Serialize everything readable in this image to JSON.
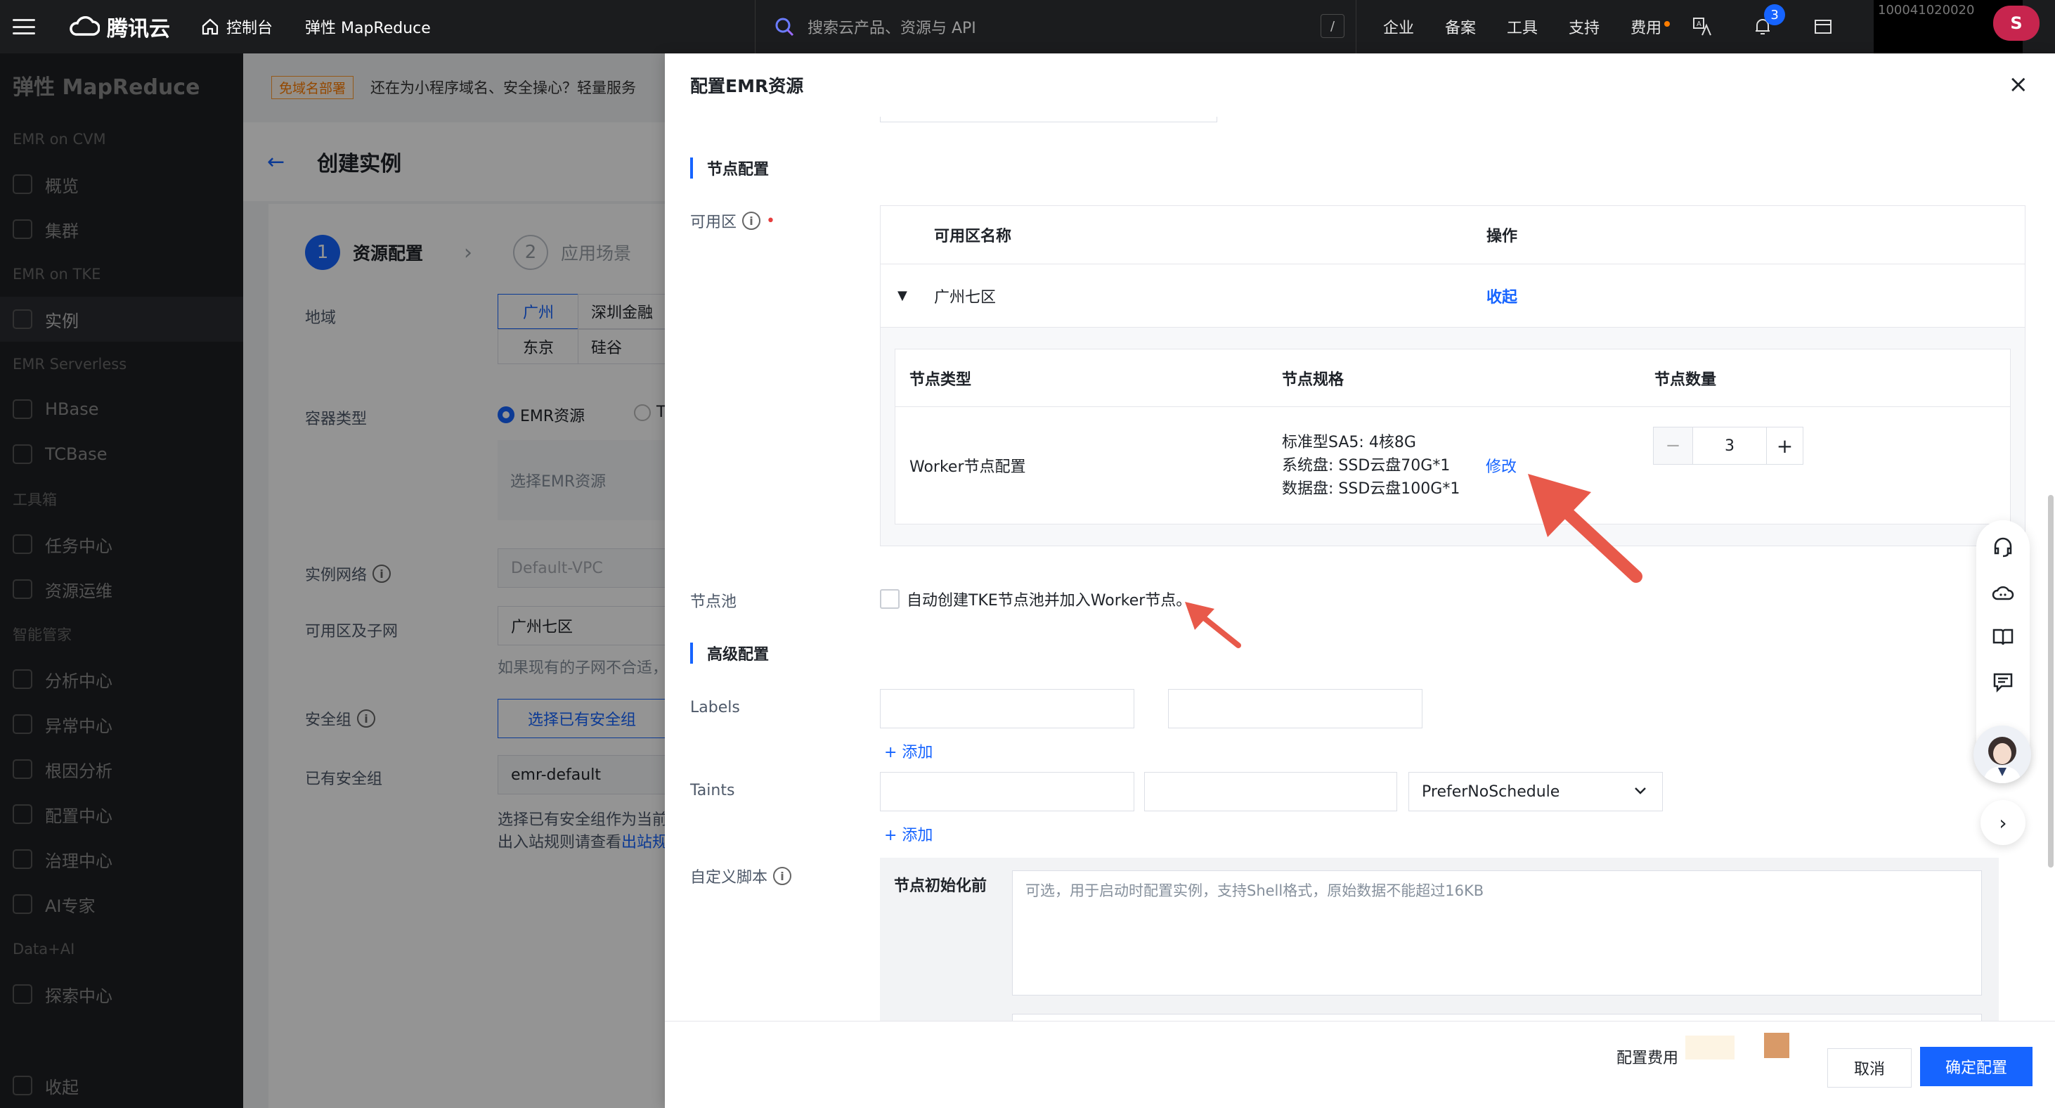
{
  "topbar": {
    "brand": "腾讯云",
    "console": "控制台",
    "product": "弹性 MapReduce",
    "search_placeholder": "搜索云产品、资源与 API",
    "search_shortcut": "/",
    "nav": [
      "企业",
      "备案",
      "工具",
      "支持",
      "费用"
    ],
    "notification_count": "3",
    "account_id": "100041020020",
    "avatar_letter": "S"
  },
  "sidebar": {
    "title": "弹性 MapReduce",
    "groups": [
      {
        "label": "EMR on CVM",
        "items": [
          {
            "label": "概览",
            "icon": "dashboard-icon"
          },
          {
            "label": "集群",
            "icon": "cluster-icon"
          }
        ]
      },
      {
        "label": "EMR on TKE",
        "items": [
          {
            "label": "实例",
            "icon": "instance-icon",
            "active": true
          }
        ]
      },
      {
        "label": "EMR Serverless",
        "items": [
          {
            "label": "HBase",
            "icon": "hbase-icon"
          },
          {
            "label": "TCBase",
            "icon": "tcbase-icon"
          }
        ]
      },
      {
        "label": "工具箱",
        "items": [
          {
            "label": "任务中心",
            "icon": "task-icon"
          },
          {
            "label": "资源运维",
            "icon": "ops-icon"
          }
        ]
      },
      {
        "label": "智能管家",
        "items": [
          {
            "label": "分析中心",
            "icon": "analysis-icon"
          },
          {
            "label": "异常中心",
            "icon": "alert-icon"
          },
          {
            "label": "根因分析",
            "icon": "rootcause-icon"
          },
          {
            "label": "配置中心",
            "icon": "config-icon"
          },
          {
            "label": "治理中心",
            "icon": "governance-icon"
          },
          {
            "label": "AI专家",
            "icon": "ai-icon"
          }
        ]
      },
      {
        "label": "Data+AI",
        "items": [
          {
            "label": "探索中心",
            "icon": "explore-icon"
          }
        ]
      }
    ],
    "collapse_label": "收起"
  },
  "main": {
    "notice_tag": "免域名部署",
    "notice_text": "还在为小程序域名、安全操心？轻量服务",
    "back_arrow": "←",
    "page_title": "创建实例",
    "steps": [
      {
        "num": "1",
        "label": "资源配置"
      },
      {
        "num": "2",
        "label": "应用场景"
      }
    ],
    "region_label": "地域",
    "regions": [
      "广州",
      "深圳金融",
      "东京",
      "硅谷"
    ],
    "container_label": "容器类型",
    "container_options": [
      "EMR资源",
      "TKE"
    ],
    "select_emr_placeholder": "选择EMR资源",
    "network_label": "实例网络",
    "network_value": "Default-VPC",
    "subnet_label": "可用区及子网",
    "subnet_value": "广州七区",
    "subnet_hint": "如果现有的子网不合适，",
    "sg_label": "安全组",
    "sg_button": "选择已有安全组",
    "existing_sg_label": "已有安全组",
    "existing_sg_value": "emr-default",
    "sg_hint_1": "选择已有安全组作为当前",
    "sg_hint_2": "出入站规则请查看",
    "sg_hint_link": "出站规"
  },
  "drawer": {
    "title": "配置EMR资源",
    "close": "×",
    "node_section": "节点配置",
    "az_label": "可用区",
    "zone_table": {
      "col_name": "可用区名称",
      "col_action": "操作",
      "row_name": "广州七区",
      "row_action": "收起"
    },
    "node_table": {
      "headers": [
        "节点类型",
        "节点规格",
        "节点数量"
      ],
      "type": "Worker节点配置",
      "spec_lines": [
        "标准型SA5: 4核8G",
        "系统盘: SSD云盘70G*1",
        "数据盘: SSD云盘100G*1"
      ],
      "modify": "修改",
      "count": "3",
      "minus": "−",
      "plus": "+"
    },
    "node_pool_label": "节点池",
    "node_pool_text": "自动创建TKE节点池并加入Worker节点。",
    "advanced_section": "高级配置",
    "labels_label": "Labels",
    "taints_label": "Taints",
    "add_label": "+ 添加",
    "taint_effect": "PreferNoSchedule",
    "script_label": "自定义脚本",
    "script_before_init": "节点初始化前",
    "script_placeholder": "可选，用于启动时配置实例，支持Shell格式，原始数据不能超过16KB",
    "fee_label": "配置费用",
    "cancel": "取消",
    "confirm": "确定配置"
  },
  "float_bar": {
    "icons": [
      "headset-icon",
      "cloud-chat-icon",
      "book-icon",
      "feedback-icon"
    ],
    "next": "›"
  },
  "colors": {
    "primary": "#1664ff",
    "annotation_arrow": "#e8594a"
  }
}
